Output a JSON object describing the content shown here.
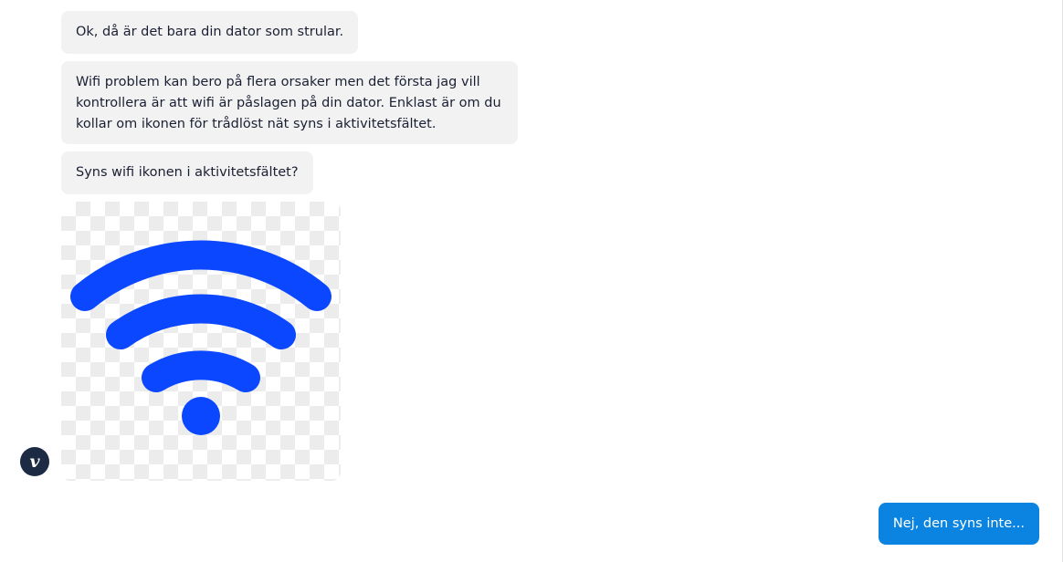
{
  "messages": [
    {
      "text": "Ok, då är det bara din dator som strular."
    },
    {
      "text": "Wifi problem kan bero på flera orsaker men det första jag vill kontrollera är att wifi är påslagen på din dator. Enklast är om du kollar om ikonen för trådlöst nät syns i aktivitetsfältet."
    },
    {
      "text": "Syns wifi ikonen i aktivitetsfältet?"
    }
  ],
  "image": {
    "icon": "wifi-icon",
    "icon_color": "#0a47ff",
    "background": "transparency-checkerboard"
  },
  "avatar": {
    "letter": "v",
    "color": "#1c2a44"
  },
  "reply": {
    "label": "Nej, den syns inte...",
    "color": "#0a84e0"
  }
}
